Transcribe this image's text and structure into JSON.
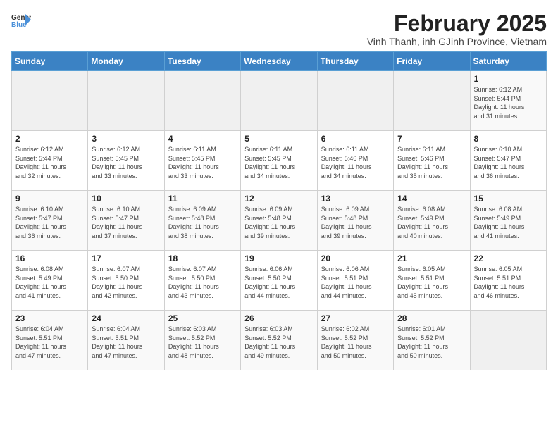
{
  "logo": {
    "text_general": "General",
    "text_blue": "Blue"
  },
  "title": "February 2025",
  "subtitle": "Vinh Thanh, inh GJinh Province, Vietnam",
  "days_of_week": [
    "Sunday",
    "Monday",
    "Tuesday",
    "Wednesday",
    "Thursday",
    "Friday",
    "Saturday"
  ],
  "weeks": [
    [
      {
        "day": "",
        "info": ""
      },
      {
        "day": "",
        "info": ""
      },
      {
        "day": "",
        "info": ""
      },
      {
        "day": "",
        "info": ""
      },
      {
        "day": "",
        "info": ""
      },
      {
        "day": "",
        "info": ""
      },
      {
        "day": "1",
        "info": "Sunrise: 6:12 AM\nSunset: 5:44 PM\nDaylight: 11 hours\nand 31 minutes."
      }
    ],
    [
      {
        "day": "2",
        "info": "Sunrise: 6:12 AM\nSunset: 5:44 PM\nDaylight: 11 hours\nand 32 minutes."
      },
      {
        "day": "3",
        "info": "Sunrise: 6:12 AM\nSunset: 5:45 PM\nDaylight: 11 hours\nand 33 minutes."
      },
      {
        "day": "4",
        "info": "Sunrise: 6:11 AM\nSunset: 5:45 PM\nDaylight: 11 hours\nand 33 minutes."
      },
      {
        "day": "5",
        "info": "Sunrise: 6:11 AM\nSunset: 5:45 PM\nDaylight: 11 hours\nand 34 minutes."
      },
      {
        "day": "6",
        "info": "Sunrise: 6:11 AM\nSunset: 5:46 PM\nDaylight: 11 hours\nand 34 minutes."
      },
      {
        "day": "7",
        "info": "Sunrise: 6:11 AM\nSunset: 5:46 PM\nDaylight: 11 hours\nand 35 minutes."
      },
      {
        "day": "8",
        "info": "Sunrise: 6:10 AM\nSunset: 5:47 PM\nDaylight: 11 hours\nand 36 minutes."
      }
    ],
    [
      {
        "day": "9",
        "info": "Sunrise: 6:10 AM\nSunset: 5:47 PM\nDaylight: 11 hours\nand 36 minutes."
      },
      {
        "day": "10",
        "info": "Sunrise: 6:10 AM\nSunset: 5:47 PM\nDaylight: 11 hours\nand 37 minutes."
      },
      {
        "day": "11",
        "info": "Sunrise: 6:09 AM\nSunset: 5:48 PM\nDaylight: 11 hours\nand 38 minutes."
      },
      {
        "day": "12",
        "info": "Sunrise: 6:09 AM\nSunset: 5:48 PM\nDaylight: 11 hours\nand 39 minutes."
      },
      {
        "day": "13",
        "info": "Sunrise: 6:09 AM\nSunset: 5:48 PM\nDaylight: 11 hours\nand 39 minutes."
      },
      {
        "day": "14",
        "info": "Sunrise: 6:08 AM\nSunset: 5:49 PM\nDaylight: 11 hours\nand 40 minutes."
      },
      {
        "day": "15",
        "info": "Sunrise: 6:08 AM\nSunset: 5:49 PM\nDaylight: 11 hours\nand 41 minutes."
      }
    ],
    [
      {
        "day": "16",
        "info": "Sunrise: 6:08 AM\nSunset: 5:49 PM\nDaylight: 11 hours\nand 41 minutes."
      },
      {
        "day": "17",
        "info": "Sunrise: 6:07 AM\nSunset: 5:50 PM\nDaylight: 11 hours\nand 42 minutes."
      },
      {
        "day": "18",
        "info": "Sunrise: 6:07 AM\nSunset: 5:50 PM\nDaylight: 11 hours\nand 43 minutes."
      },
      {
        "day": "19",
        "info": "Sunrise: 6:06 AM\nSunset: 5:50 PM\nDaylight: 11 hours\nand 44 minutes."
      },
      {
        "day": "20",
        "info": "Sunrise: 6:06 AM\nSunset: 5:51 PM\nDaylight: 11 hours\nand 44 minutes."
      },
      {
        "day": "21",
        "info": "Sunrise: 6:05 AM\nSunset: 5:51 PM\nDaylight: 11 hours\nand 45 minutes."
      },
      {
        "day": "22",
        "info": "Sunrise: 6:05 AM\nSunset: 5:51 PM\nDaylight: 11 hours\nand 46 minutes."
      }
    ],
    [
      {
        "day": "23",
        "info": "Sunrise: 6:04 AM\nSunset: 5:51 PM\nDaylight: 11 hours\nand 47 minutes."
      },
      {
        "day": "24",
        "info": "Sunrise: 6:04 AM\nSunset: 5:51 PM\nDaylight: 11 hours\nand 47 minutes."
      },
      {
        "day": "25",
        "info": "Sunrise: 6:03 AM\nSunset: 5:52 PM\nDaylight: 11 hours\nand 48 minutes."
      },
      {
        "day": "26",
        "info": "Sunrise: 6:03 AM\nSunset: 5:52 PM\nDaylight: 11 hours\nand 49 minutes."
      },
      {
        "day": "27",
        "info": "Sunrise: 6:02 AM\nSunset: 5:52 PM\nDaylight: 11 hours\nand 50 minutes."
      },
      {
        "day": "28",
        "info": "Sunrise: 6:01 AM\nSunset: 5:52 PM\nDaylight: 11 hours\nand 50 minutes."
      },
      {
        "day": "",
        "info": ""
      }
    ]
  ]
}
